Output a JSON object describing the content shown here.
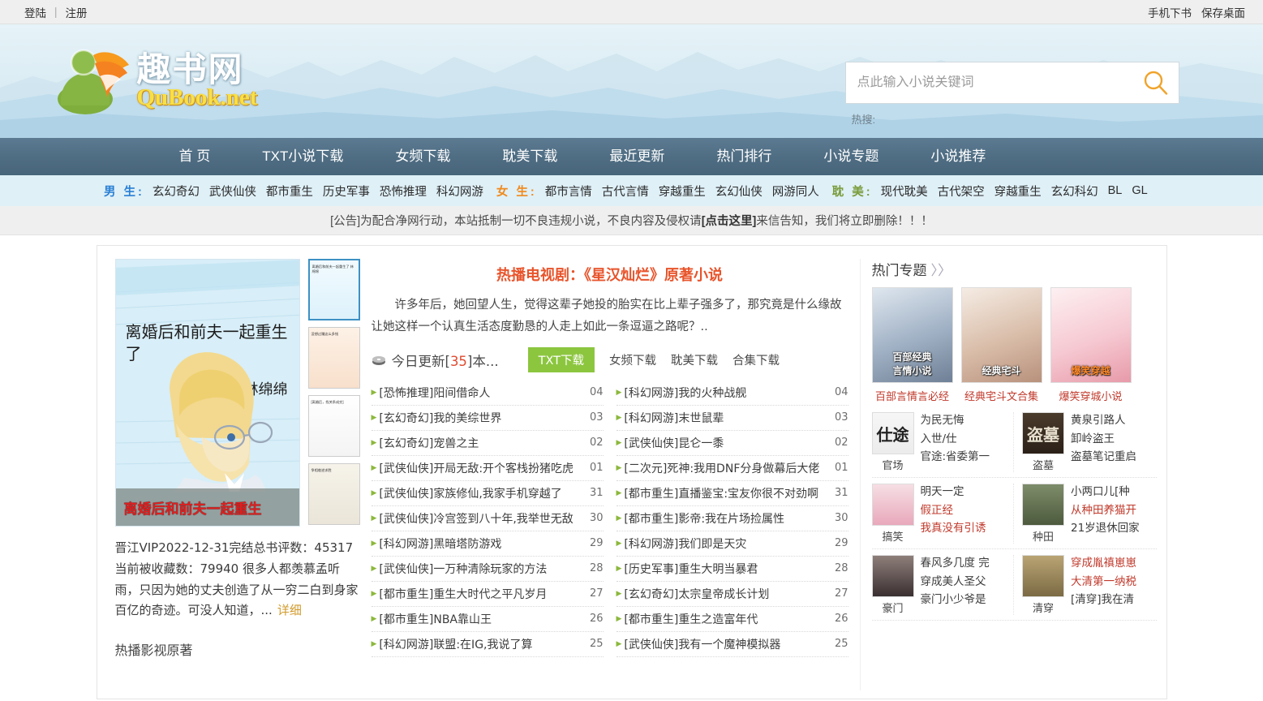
{
  "topbar": {
    "login": "登陆",
    "separator": "|",
    "register": "注册",
    "mobile": "手机下书",
    "desktop": "保存桌面"
  },
  "logo": {
    "cn": "趣书网",
    "en": "QuBook.net"
  },
  "search": {
    "placeholder": "点此输入小说关键词",
    "icon": "search-icon",
    "hot_label": "热搜:"
  },
  "nav": {
    "items": [
      "首 页",
      "TXT小说下载",
      "女频下载",
      "耽美下载",
      "最近更新",
      "热门排行",
      "小说专题",
      "小说推荐"
    ]
  },
  "categories": {
    "groups": [
      {
        "label": "男 生:",
        "color": "#2a7fd4",
        "items": [
          "玄幻奇幻",
          "武侠仙侠",
          "都市重生",
          "历史军事",
          "恐怖推理",
          "科幻网游"
        ]
      },
      {
        "label": "女 生:",
        "color": "#f08a1e",
        "items": [
          "都市言情",
          "古代言情",
          "穿越重生",
          "玄幻仙侠",
          "网游同人"
        ]
      },
      {
        "label": "耽 美:",
        "color": "#7a9c3c",
        "items": [
          "现代耽美",
          "古代架空",
          "穿越重生",
          "玄幻科幻",
          "BL",
          "GL"
        ]
      }
    ]
  },
  "notice": {
    "prefix": "[公告]为配合净网行动，本站抵制一切不良违规小说，不良内容及侵权请",
    "link": "[点击这里]",
    "suffix": "来信告知，我们将立即删除！！！"
  },
  "featured_book": {
    "cover_title": "离婚后和前夫一起重生了",
    "cover_author": "林绵绵",
    "band_title": "离婚后和前夫一起重生",
    "thumbs": [
      "离婚后和前夫一起重生了 林绵绵",
      "没想过赚这么多钱",
      "[离婚后，找关系成交]",
      "争相临逆求胜"
    ],
    "meta_line1": "晋江VIP2022-12-31完结总书评数：45317",
    "meta_line2": "当前被收藏数：79940  很多人都羡慕孟听雨，只因为她的丈夫创造了从一穷二白到身家百亿的奇迹。可没人知道，...",
    "more": "详细",
    "sub_section": "热播影视原著"
  },
  "feature": {
    "title": "热播电视剧：《星汉灿烂》原著小说",
    "text": "许多年后，她回望人生，觉得这辈子她投的胎实在比上辈子强多了，那究竟是什么缘故让她这样一个认真生活态度勤恳的人走上如此一条逗逼之路呢？..",
    "today_prefix": "今日更新[",
    "today_count": "35",
    "today_suffix": "]本...",
    "downloads": {
      "primary": "TXT下载",
      "links": [
        "女频下载",
        "耽美下载",
        "合集下载"
      ]
    }
  },
  "novel_list": {
    "left": [
      {
        "cat": "[恐怖推理]",
        "title": "阳间借命人",
        "day": "04"
      },
      {
        "cat": "[玄幻奇幻]",
        "title": "我的美综世界",
        "day": "03"
      },
      {
        "cat": "[玄幻奇幻]",
        "title": "宠兽之主",
        "day": "02"
      },
      {
        "cat": "[武侠仙侠]",
        "title": "开局无敌:开个客栈扮猪吃虎",
        "day": "01"
      },
      {
        "cat": "[武侠仙侠]",
        "title": "家族修仙,我家手机穿越了",
        "day": "31"
      },
      {
        "cat": "[武侠仙侠]",
        "title": "冷宫签到八十年,我举世无敌",
        "day": "30"
      },
      {
        "cat": "[科幻网游]",
        "title": "黑暗塔防游戏",
        "day": "29"
      },
      {
        "cat": "[武侠仙侠]",
        "title": "一万种清除玩家的方法",
        "day": "28"
      },
      {
        "cat": "[都市重生]",
        "title": "重生大时代之平凡岁月",
        "day": "27"
      },
      {
        "cat": "[都市重生]",
        "title": "NBA靠山王",
        "day": "26"
      },
      {
        "cat": "[科幻网游]",
        "title": "联盟:在IG,我说了算",
        "day": "25"
      }
    ],
    "right": [
      {
        "cat": "[科幻网游]",
        "title": "我的火种战舰",
        "day": "04"
      },
      {
        "cat": "[科幻网游]",
        "title": "末世鼠辈",
        "day": "03"
      },
      {
        "cat": "[武侠仙侠]",
        "title": "昆仑一黍",
        "day": "02"
      },
      {
        "cat": "[二次元]",
        "title": "死神:我用DNF分身做幕后大佬",
        "day": "01"
      },
      {
        "cat": "[都市重生]",
        "title": "直播鉴宝:宝友你很不对劲啊",
        "day": "31"
      },
      {
        "cat": "[都市重生]",
        "title": "影帝:我在片场捡属性",
        "day": "30"
      },
      {
        "cat": "[科幻网游]",
        "title": "我们即是天灾",
        "day": "29"
      },
      {
        "cat": "[历史军事]",
        "title": "重生大明当暴君",
        "day": "28"
      },
      {
        "cat": "[玄幻奇幻]",
        "title": "太宗皇帝成长计划",
        "day": "27"
      },
      {
        "cat": "[都市重生]",
        "title": "重生之造富年代",
        "day": "26"
      },
      {
        "cat": "[武侠仙侠]",
        "title": "我有一个魔神模拟器",
        "day": "25"
      }
    ]
  },
  "sidebar": {
    "title": "热门专题",
    "more": "〉〉",
    "topics": [
      {
        "overlay": "百部经典\n言情小说",
        "caption": "百部言情言必经",
        "overlay_color": "#ffffff"
      },
      {
        "overlay": "经典宅斗",
        "caption": "经典宅斗文合集",
        "overlay_color": "#ffffff"
      },
      {
        "overlay": "爆笑穿越",
        "caption": "爆笑穿城小说",
        "overlay_color": "#ff8a2b"
      }
    ],
    "cat_blocks": [
      {
        "name": "官场",
        "thumb_text": "仕途",
        "links": [
          {
            "text": "为民无悔",
            "red": false
          },
          {
            "text": "入世/仕",
            "red": false
          },
          {
            "text": "官途:省委第一",
            "red": false
          }
        ]
      },
      {
        "name": "盗墓",
        "thumb_text": "盗墓",
        "links": [
          {
            "text": "黄泉引路人",
            "red": false
          },
          {
            "text": "卸岭盗王",
            "red": false
          },
          {
            "text": "盗墓笔记重启",
            "red": false
          }
        ]
      },
      {
        "name": "搞笑",
        "thumb_text": "",
        "links": [
          {
            "text": "明天一定",
            "red": false
          },
          {
            "text": "假正经",
            "red": true
          },
          {
            "text": "我真没有引诱",
            "red": true
          }
        ]
      },
      {
        "name": "种田",
        "thumb_text": "",
        "links": [
          {
            "text": "小两口儿[种",
            "red": false
          },
          {
            "text": "从种田养猫开",
            "red": true
          },
          {
            "text": "21岁退休回家",
            "red": false
          }
        ]
      },
      {
        "name": "豪门",
        "thumb_text": "",
        "links": [
          {
            "text": "春风多几度 完",
            "red": false
          },
          {
            "text": "穿成美人圣父",
            "red": false
          },
          {
            "text": "豪门小少爷是",
            "red": false
          }
        ]
      },
      {
        "name": "清穿",
        "thumb_text": "",
        "links": [
          {
            "text": "穿成胤禛崽崽",
            "red": true
          },
          {
            "text": "大清第一纳税",
            "red": true
          },
          {
            "text": "[清穿]我在清",
            "red": false
          }
        ]
      }
    ]
  },
  "colors": {
    "accent_orange": "#e8542b",
    "green_button": "#8cc63f",
    "nav_blue": "#4f6d83",
    "category_bg": "#dff0f7"
  }
}
